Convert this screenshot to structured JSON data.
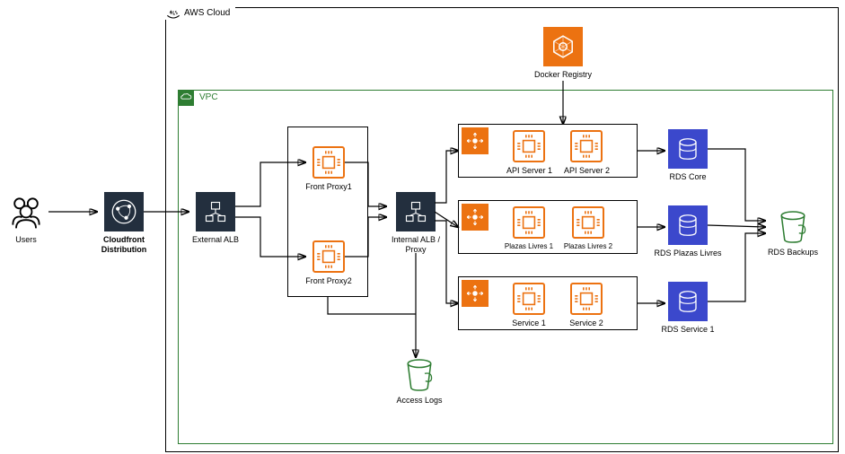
{
  "aws_label": "AWS Cloud",
  "vpc_label": "VPC",
  "users": {
    "label": "Users"
  },
  "cloudfront": {
    "label": "Cloudfront\nDistribution"
  },
  "external_alb": {
    "label": "External ALB"
  },
  "front_proxy1": {
    "label": "Front Proxy1"
  },
  "front_proxy2": {
    "label": "Front Proxy2"
  },
  "internal_alb": {
    "label": "Internal ALB /\nProxy"
  },
  "access_logs": {
    "label": "Access Logs"
  },
  "docker_registry": {
    "label": "Docker Registry"
  },
  "service_rows": [
    {
      "server1": "API Server 1",
      "server2": "API Server 2",
      "rds": "RDS Core"
    },
    {
      "server1": "Plazas Livres 1",
      "server2": "Plazas Livres 2",
      "rds": "RDS Plazas Livres"
    },
    {
      "server1": "Service 1",
      "server2": "Service 2",
      "rds": "RDS Service 1"
    }
  ],
  "rds_backups": {
    "label": "RDS Backups"
  },
  "colors": {
    "dark": "#232f3e",
    "orange": "#ec7211",
    "blue": "#3b48cc",
    "green": "#2e7d32"
  }
}
